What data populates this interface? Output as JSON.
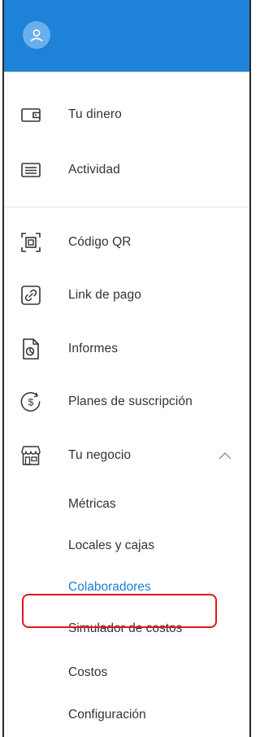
{
  "header": {
    "avatar_icon": "user-icon",
    "accent": "#1e82d8"
  },
  "nav": {
    "section1": [
      {
        "id": "tu-dinero",
        "label": "Tu dinero",
        "icon": "wallet-icon"
      },
      {
        "id": "actividad",
        "label": "Actividad",
        "icon": "list-icon"
      }
    ],
    "section2": [
      {
        "id": "codigo-qr",
        "label": "Código QR",
        "icon": "qr-code-icon"
      },
      {
        "id": "link-pago",
        "label": "Link de pago",
        "icon": "link-icon"
      },
      {
        "id": "informes",
        "label": "Informes",
        "icon": "report-icon"
      },
      {
        "id": "planes",
        "label": "Planes de suscripción",
        "icon": "dollar-cycle-icon"
      },
      {
        "id": "tu-negocio",
        "label": "Tu negocio",
        "icon": "store-icon",
        "expanded": true
      }
    ],
    "submenu": [
      {
        "label": "Métricas"
      },
      {
        "label": "Locales y cajas"
      },
      {
        "label": "Colaboradores",
        "active": true
      },
      {
        "label": "Simulador de costos"
      },
      {
        "label": "Costos"
      },
      {
        "label": "Configuración"
      }
    ]
  },
  "colors": {
    "active_text": "#1b7fd6",
    "highlight_border": "#e0161e"
  }
}
